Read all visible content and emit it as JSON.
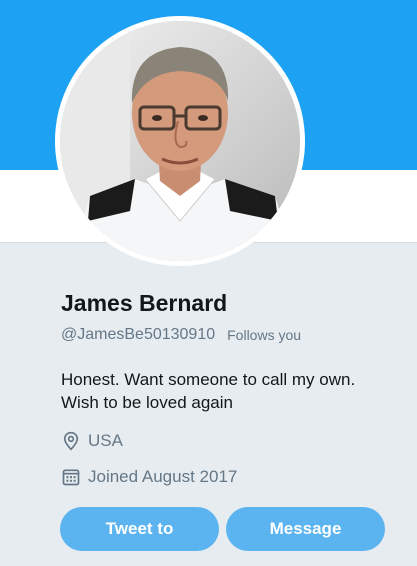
{
  "profile": {
    "name": "James Bernard",
    "handle": "@JamesBe50130910",
    "follows_you": "Follows you",
    "bio_line1": "Honest. Want someone to call my own.",
    "bio_line2": "Wish to be loved again",
    "location": "USA",
    "joined": "Joined August 2017",
    "avatar_alt": "Profile photo of a man in a white uniform shirt"
  },
  "actions": {
    "tweet_to": "Tweet to",
    "message": "Message"
  },
  "icons": {
    "location": "map-pin-icon",
    "joined": "calendar-icon"
  },
  "colors": {
    "header": "#1da1f2",
    "button": "#5bb4ef",
    "background": "#e6ecf0",
    "name": "#14171a",
    "secondary": "#657786"
  }
}
